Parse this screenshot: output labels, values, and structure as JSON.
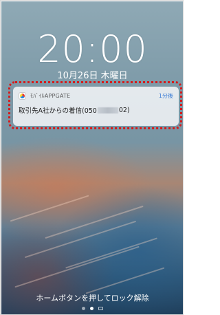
{
  "lock_screen": {
    "time": "20:00",
    "date": "10月26日 木曜日",
    "unlock_hint": "ホームボタンを押してロック解除",
    "page_dots": [
      "dot",
      "dot-active",
      "camera-icon"
    ]
  },
  "notification": {
    "app_icon": "app-logo-icon",
    "app_name": "ﾓﾊﾞｲﾙAPPGATE",
    "time_ago": "1分後",
    "message_prefix": "取引先A社からの着信(050",
    "message_suffix": "02)",
    "highlight_color": "#d61a1a"
  }
}
